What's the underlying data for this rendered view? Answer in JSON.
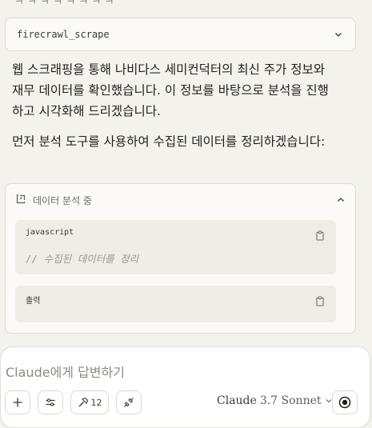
{
  "tool_call": {
    "name": "firecrawl_scrape"
  },
  "messages": [
    "웹 스크래핑을 통해 나비다스 세미컨덕터의 최신 주가 정보와 재무 데이터를 확인했습니다. 이 정보를 바탕으로 분석을 진행하고 시각화해 드리겠습니다.",
    "먼저 분석 도구를 사용하여 수집된 데이터를 정리하겠습니다:"
  ],
  "analysis": {
    "title": "데이터 분석 중",
    "code_block": {
      "language": "javascript",
      "comment": "// 수집된 데이터를 정리"
    },
    "output_block": {
      "label": "출력"
    }
  },
  "composer": {
    "placeholder": "Claude에게 답변하기",
    "tools_count": "12",
    "model_name": "Claude",
    "model_version": "3.7 Sonnet"
  }
}
